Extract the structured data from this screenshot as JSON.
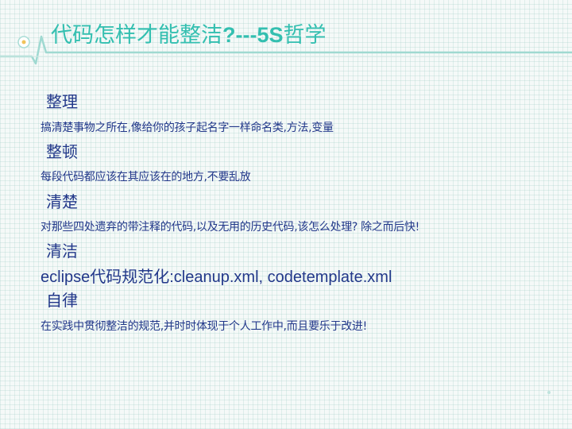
{
  "slide": {
    "title_cn": "代码怎样才能整洁",
    "title_latin": "?---5S",
    "title_suffix": "哲学",
    "items": [
      {
        "heading": "整理",
        "detail": "搞清楚事物之所在,像给你的孩子起名字一样命名类,方法,变量"
      },
      {
        "heading": "整顿",
        "detail": "每段代码都应该在其应该在的地方,不要乱放"
      },
      {
        "heading": "清楚",
        "detail": "对那些四处遗弃的带注释的代码,以及无用的历史代码,该怎么处理? 除之而后快!"
      },
      {
        "heading": "清洁",
        "detail": "eclipse代码规范化:cleanup.xml, codetemplate.xml"
      },
      {
        "heading": "自律",
        "detail": "在实践中贯彻整洁的规范,并时时体现于个人工作中,而且要乐于改进!"
      }
    ]
  },
  "colors": {
    "title": "#33bfb0",
    "text": "#22388a",
    "accent_line": "#9fd9d1",
    "background": "#f5f9f8"
  },
  "icons": [
    "heartbeat-line-decoration",
    "circle-node-decoration"
  ]
}
